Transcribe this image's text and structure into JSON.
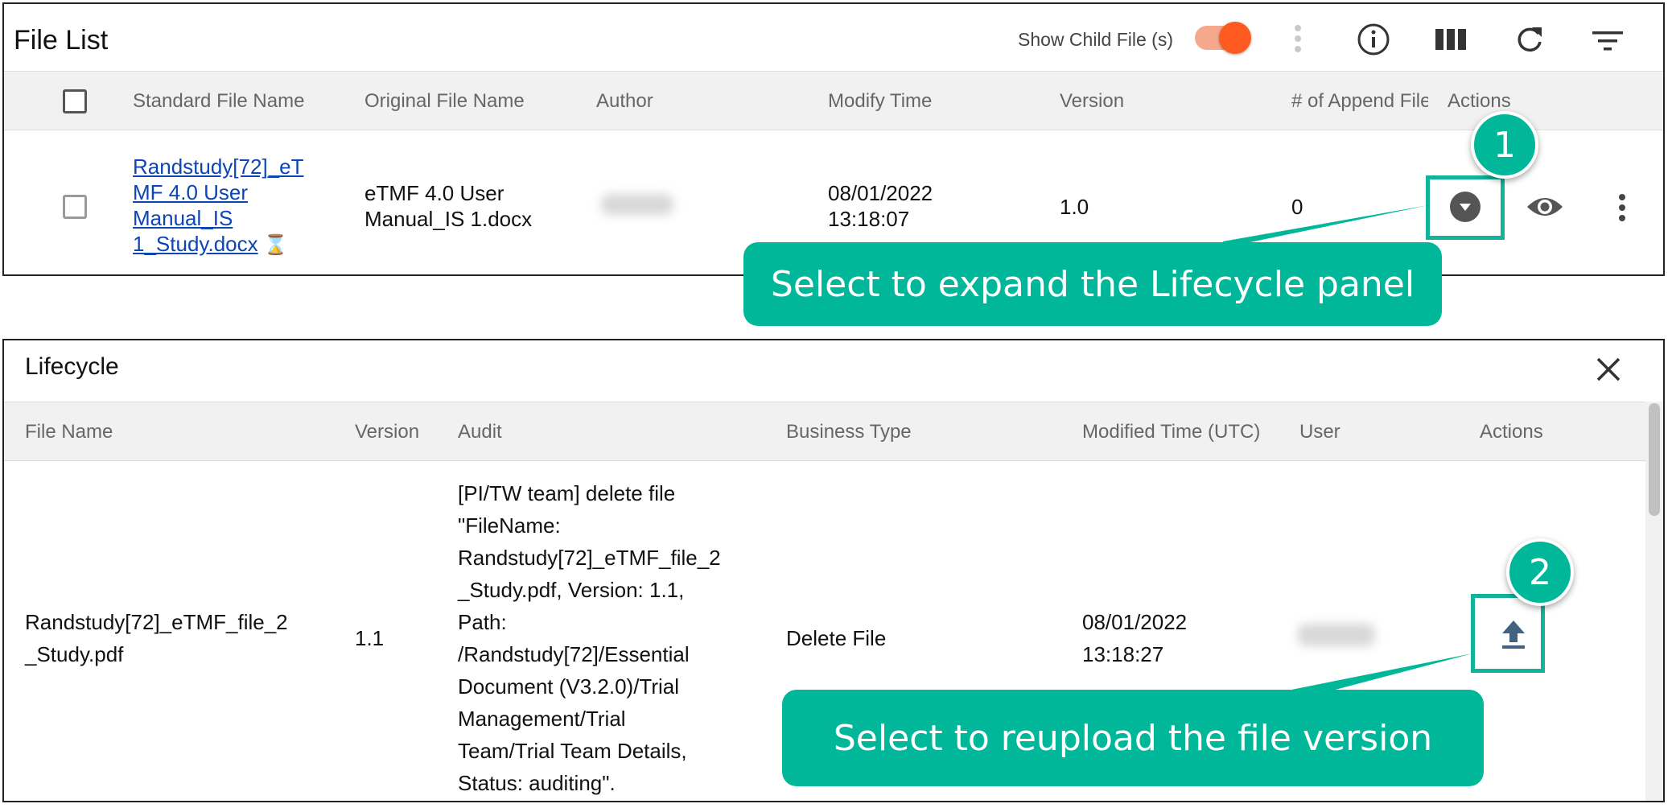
{
  "file_list": {
    "title": "File List",
    "show_child_label": "Show Child File (s)",
    "columns": {
      "standard": "Standard File Name",
      "original": "Original File Name",
      "author": "Author",
      "modify": "Modify Time",
      "version": "Version",
      "append": "# of Append File",
      "actions": "Actions"
    },
    "row": {
      "standard_line1": "Randstudy[72]_eT",
      "standard_line2": "MF 4.0 User",
      "standard_line3": "Manual_IS",
      "standard_line4": "1_Study.docx",
      "hourglass": "⌛",
      "original_line1": "eTMF 4.0 User",
      "original_line2": "Manual_IS 1.docx",
      "modify_line1": "08/01/2022",
      "modify_line2": "13:18:07",
      "version": "1.0",
      "append": "0"
    }
  },
  "lifecycle": {
    "title": "Lifecycle",
    "columns": {
      "file_name": "File Name",
      "version": "Version",
      "audit": "Audit",
      "business": "Business Type",
      "modified": "Modified Time (UTC)",
      "user": "User",
      "actions": "Actions"
    },
    "row": {
      "file_line1": "Randstudy[72]_eTMF_file_2",
      "file_line2": "_Study.pdf",
      "version": "1.1",
      "audit_lines": [
        "[PI/TW team] delete file",
        "\"FileName:",
        "Randstudy[72]_eTMF_file_2",
        "_Study.pdf, Version: 1.1,",
        "Path:",
        "/Randstudy[72]/Essential",
        "Document (V3.2.0)/Trial",
        "Management/Trial",
        "Team/Trial Team Details,",
        "Status: auditing\"."
      ],
      "business": "Delete File",
      "modified_line1": "08/01/2022",
      "modified_line2": "13:18:27"
    }
  },
  "callouts": {
    "c1_number": "1",
    "c1_text": "Select to expand the Lifecycle panel",
    "c2_number": "2",
    "c2_text": "Select to reupload the file version"
  },
  "colors": {
    "accent": "#00b79a",
    "toggle_on": "#ff5a1f",
    "link": "#0b46b4"
  }
}
